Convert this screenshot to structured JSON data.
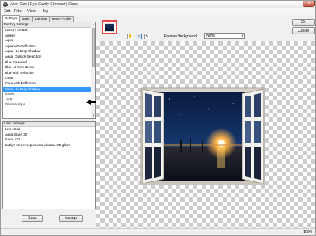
{
  "window": {
    "title": "Alien Skin | Eye Candy 5 Impact | Glass",
    "close_glyph": "✕",
    "app_icon_glyph": "◐"
  },
  "menu": [
    "Edit",
    "Filter",
    "View",
    "Help"
  ],
  "tabs": [
    "Settings",
    "Basic",
    "Lighting",
    "Bevel Profile"
  ],
  "factory_settings": {
    "header": "Factory Settings",
    "items": [
      "Factory Default",
      "Amber",
      "Aqua",
      "Aqua with Reflection",
      "Aqua, No Drop Shadow",
      "Aqua, Outside Selection",
      "Blue Flattened",
      "Blue Lit from Below",
      "Blue with Reflection",
      "Clear",
      "Clear with Reflection",
      "Clear, No Drop Shadow",
      "Green",
      "Jade",
      "Opaque Aqua"
    ],
    "selected_index": 11
  },
  "user_settings": {
    "header": "User Settings",
    "items": [
      "Last Used",
      "Aqua Glass 30",
      "Glass 123",
      "Kathys-screencopies-ana-window-UD glass"
    ]
  },
  "buttons": {
    "save": "Save",
    "manage": "Manage",
    "ok": "OK",
    "cancel": "Cancel"
  },
  "toolbar": {
    "preview_background_label": "Preview Background:",
    "preview_background_value": "None",
    "tool_icons": [
      "hand-icon",
      "zoom-icon",
      "eyedropper-icon"
    ]
  },
  "status": {
    "zoom": "100%"
  }
}
